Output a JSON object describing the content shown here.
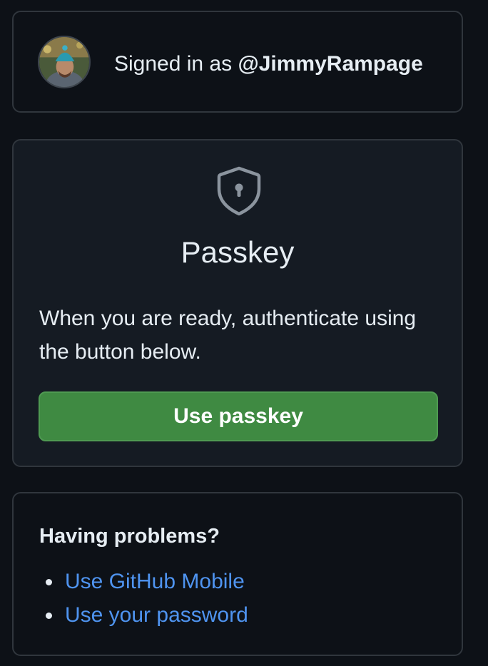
{
  "signed_in": {
    "prefix": "Signed in as",
    "username": "@JimmyRampage",
    "avatar_icon": "user-avatar"
  },
  "passkey": {
    "icon": "shield-lock-icon",
    "title": "Passkey",
    "description": "When you are ready, authenticate using the button below.",
    "button_label": "Use passkey",
    "button_color": "#3f8a42"
  },
  "problems": {
    "title": "Having problems?",
    "links": [
      {
        "label": "Use GitHub Mobile"
      },
      {
        "label": "Use your password"
      }
    ],
    "link_color": "#4f94f0"
  },
  "theme": {
    "background": "#0d1117",
    "panel": "#151b23",
    "border": "#30363d",
    "text": "#e6edf3"
  }
}
